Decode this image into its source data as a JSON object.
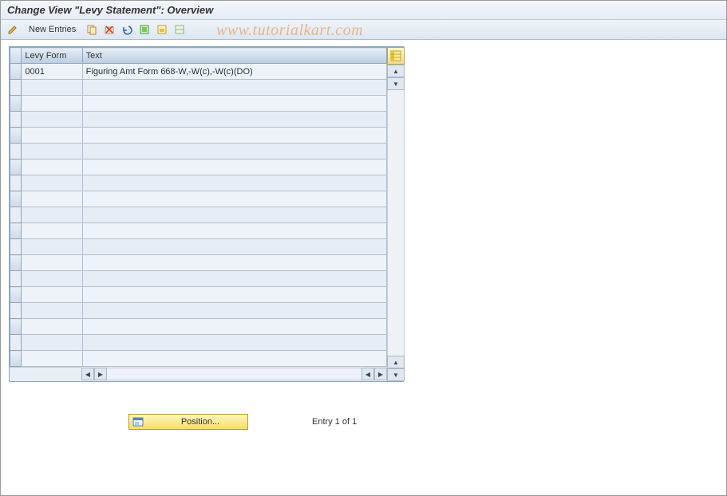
{
  "title": "Change View \"Levy Statement\": Overview",
  "toolbar": {
    "new_entries_label": "New Entries"
  },
  "watermark": "www.tutorialkart.com",
  "table": {
    "headers": {
      "levy_form": "Levy Form",
      "text": "Text"
    },
    "rows": [
      {
        "levy_form": "0001",
        "text": "Figuring Amt Form 668-W,-W(c),-W(c)(DO)"
      }
    ]
  },
  "footer": {
    "position_label": "Position...",
    "entry_text": "Entry 1 of 1"
  }
}
